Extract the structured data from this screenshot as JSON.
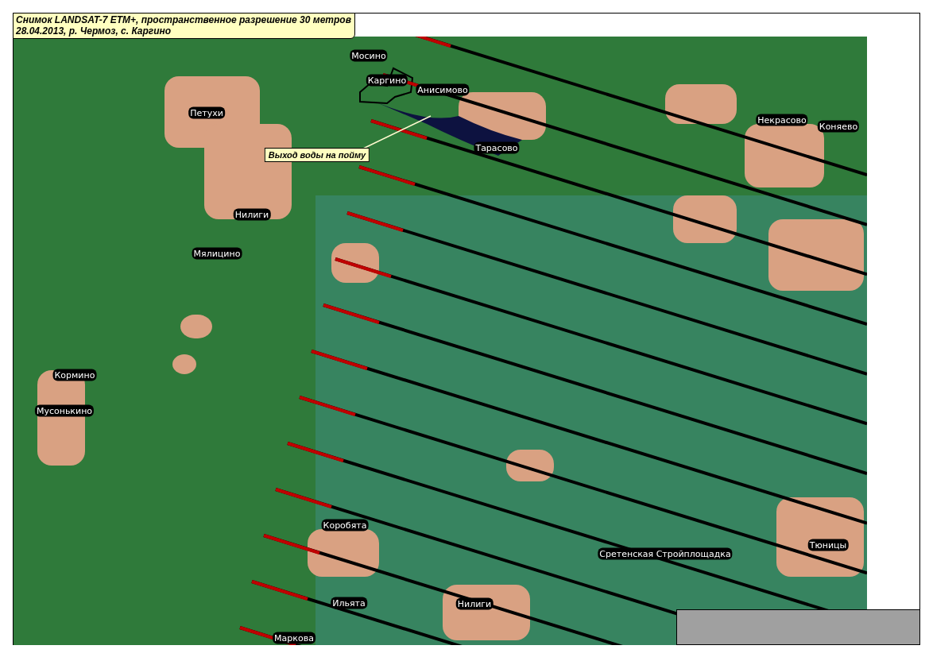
{
  "title": {
    "lines": [
      "Снимок LANDSAT-7 ETM+, пространственное разрешение 30 метров",
      "28.04.2013, р. Чермоз, с. Каргино"
    ]
  },
  "map": {
    "labels": [
      {
        "kind": "place",
        "text": "Мосино"
      },
      {
        "kind": "place",
        "text": "Каргино"
      },
      {
        "kind": "place",
        "text": "Анисимово"
      },
      {
        "kind": "place",
        "text": "Петухи"
      },
      {
        "kind": "place",
        "text": "Некрасово"
      },
      {
        "kind": "place",
        "text": "Коняево"
      },
      {
        "kind": "place",
        "text": "Тарасово"
      },
      {
        "kind": "callout",
        "text": "Выход воды на пойму"
      },
      {
        "kind": "place",
        "text": "Нилиги"
      },
      {
        "kind": "place",
        "text": "Мялицино"
      },
      {
        "kind": "place",
        "text": "Кормино"
      },
      {
        "kind": "place",
        "text": "Мусонькино"
      },
      {
        "kind": "place",
        "text": "Коробята"
      },
      {
        "kind": "place",
        "text": "Сретенская Стройплощадка"
      },
      {
        "kind": "place",
        "text": "Тюницы"
      },
      {
        "kind": "place",
        "text": "Ильята"
      },
      {
        "kind": "place",
        "text": "Нилиги"
      },
      {
        "kind": "place",
        "text": "Маркова"
      }
    ]
  }
}
